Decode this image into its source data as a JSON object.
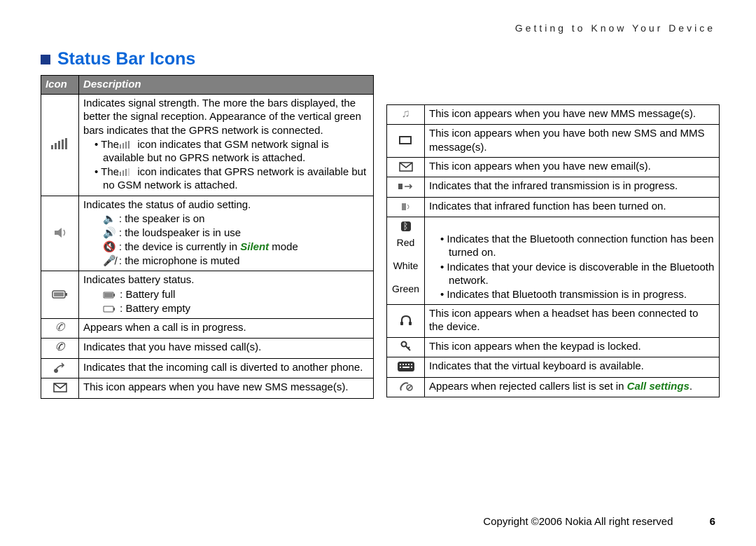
{
  "running_head": "Getting to Know Your Device",
  "heading": "Status Bar Icons",
  "table_headers": {
    "icon": "Icon",
    "desc": "Description"
  },
  "left_rows": {
    "signal": {
      "main": "Indicates signal strength. The more the bars displayed, the better the signal reception. Appearance of the vertical green bars indicates that the GPRS network is connected.",
      "b1a": "The ",
      "b1b": " icon indicates that GSM network signal is available but no GPRS network is attached.",
      "b2a": "The ",
      "b2b": " icon indicates that GPRS network is available but no GSM network is attached."
    },
    "audio": {
      "main": "Indicates the status of audio setting.",
      "s1": " : the speaker is on",
      "s2": " : the loudspeaker is in use",
      "s3a": " : the device is currently in ",
      "s3b": "Silent",
      "s3c": " mode",
      "s4": " : the microphone is muted"
    },
    "battery": {
      "main": "Indicates battery status.",
      "s1": " : Battery full",
      "s2": " : Battery empty"
    },
    "call": "Appears when a call is in progress.",
    "missed": "Indicates that you have missed call(s).",
    "divert": "Indicates that the incoming call is diverted to another phone.",
    "sms": "This icon appears when you have new SMS message(s)."
  },
  "right_rows": {
    "mms": "This icon appears when you have new MMS message(s).",
    "both": "This icon appears when you have both new SMS and MMS message(s).",
    "email": "This icon appears when you have new email(s).",
    "ir_tx": "Indicates that the infrared transmission is in progress.",
    "ir_on": "Indicates that infrared function has been turned on.",
    "bt": {
      "red_label": "Red",
      "white_label": "White",
      "green_label": "Green",
      "red": "Indicates that the Bluetooth connection function has been turned on.",
      "white": "Indicates that your device is discoverable in the Bluetooth network.",
      "green": "Indicates that Bluetooth transmission is in progress."
    },
    "headset": "This icon appears when a headset has been connected to the device.",
    "keylock": "This icon appears when the keypad is locked.",
    "vkb": "Indicates that the virtual keyboard is available.",
    "reject_a": "Appears when rejected callers list is set in ",
    "reject_b": "Call settings",
    "reject_c": "."
  },
  "footer": {
    "copyright": "Copyright ©2006 Nokia All right reserved",
    "page": "6"
  }
}
